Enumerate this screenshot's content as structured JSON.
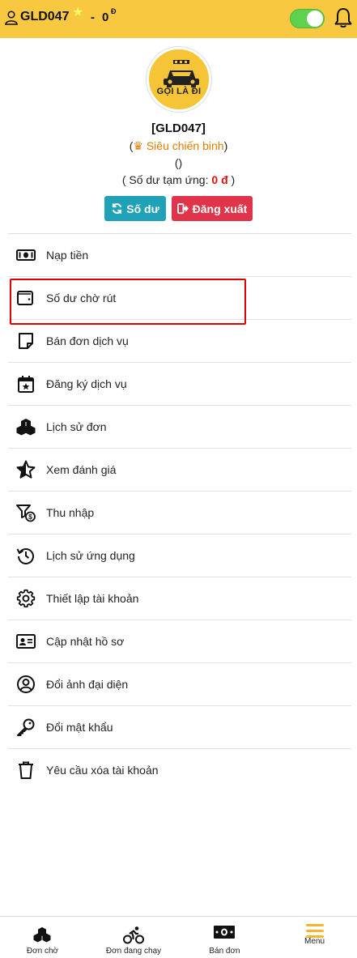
{
  "header": {
    "username": "GLD047",
    "separator": "-",
    "balance": "0",
    "balance_currency": "Đ",
    "online_toggle": true,
    "accent_color": "#f8c840"
  },
  "profile": {
    "avatar_logo_text": "GỌI LÀ ĐI",
    "name": "[GLD047]",
    "rank_open": "(",
    "rank_label": "Siêu chiến binh",
    "rank_close": ")",
    "extra": "()",
    "advance_prefix": "( Số dư tạm ứng: ",
    "advance_amount": "0 đ",
    "advance_suffix": " )"
  },
  "actions": {
    "balance_label": "Số dư",
    "logout_label": "Đăng xuất"
  },
  "menu": [
    {
      "label": "Nạp tiền",
      "icon": "money-bill-icon"
    },
    {
      "label": "Số dư chờ rút",
      "icon": "wallet-icon"
    },
    {
      "label": "Bán đơn dịch vụ",
      "icon": "sticky-note-icon"
    },
    {
      "label": "Đăng ký dịch vụ",
      "icon": "calendar-star-icon"
    },
    {
      "label": "Lịch sử đơn",
      "icon": "boxes-icon"
    },
    {
      "label": "Xem đánh giá",
      "icon": "star-half-icon"
    },
    {
      "label": "Thu nhập",
      "icon": "filter-dollar-icon"
    },
    {
      "label": "Lịch sử ứng dụng",
      "icon": "history-icon"
    },
    {
      "label": "Thiết lập tài khoản",
      "icon": "gear-icon"
    },
    {
      "label": "Cập nhật hồ sơ",
      "icon": "id-card-icon"
    },
    {
      "label": "Đổi ảnh đại diện",
      "icon": "user-circle-icon"
    },
    {
      "label": "Đổi mật khẩu",
      "icon": "key-icon"
    },
    {
      "label": "Yêu cầu xóa tài khoản",
      "icon": "trash-icon"
    }
  ],
  "bottom_nav": [
    {
      "label": "Đơn chờ",
      "icon": "boxes-icon"
    },
    {
      "label": "Đơn đang chạy",
      "icon": "cyclist-icon"
    },
    {
      "label": "Bán đơn",
      "icon": "money-bill-icon"
    },
    {
      "label": "Menu",
      "icon": "hamburger-icon"
    }
  ]
}
